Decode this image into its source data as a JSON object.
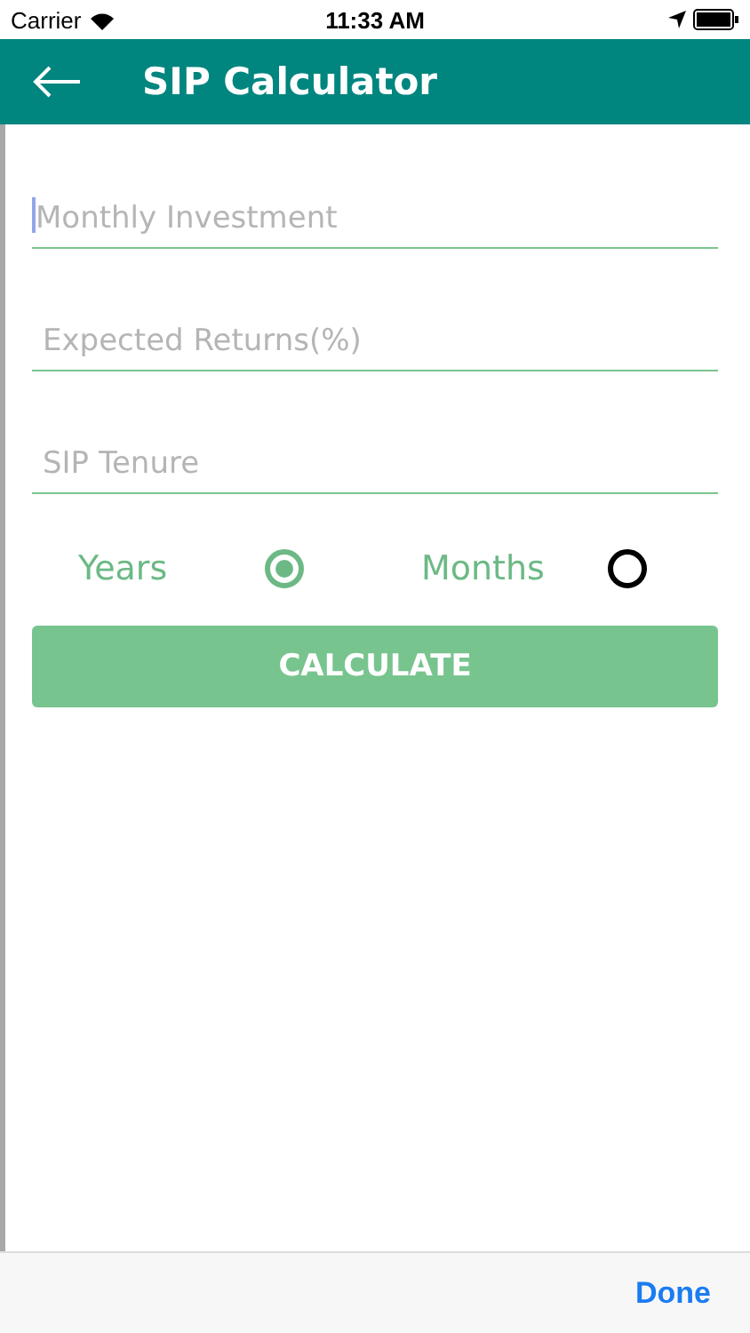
{
  "status_bar": {
    "carrier": "Carrier",
    "time": "11:33 AM"
  },
  "header": {
    "title": "SIP Calculator"
  },
  "fields": [
    {
      "placeholder": "Monthly Investment",
      "focused": true
    },
    {
      "placeholder": "Expected Returns(%)",
      "focused": false
    },
    {
      "placeholder": "SIP Tenure",
      "focused": false
    }
  ],
  "tenure_units": [
    {
      "label": "Years",
      "selected": true
    },
    {
      "label": "Months",
      "selected": false
    }
  ],
  "calculate_button": "CALCULATE",
  "keyboard_toolbar": {
    "done": "Done"
  }
}
